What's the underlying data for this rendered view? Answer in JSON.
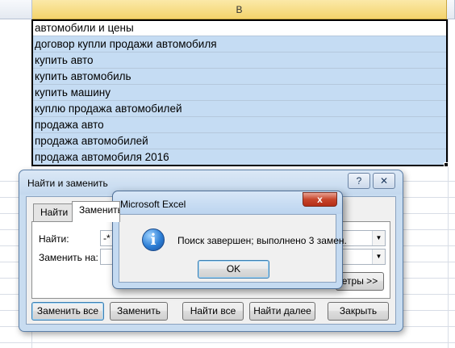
{
  "sheet": {
    "column_b_header": "B",
    "rows": [
      "автомобили и цены",
      "договор купли продажи автомобиля",
      "купить авто",
      "купить автомобиль",
      "купить машину",
      "куплю продажа автомобилей",
      "продажа авто",
      "продажа автомобилей",
      "продажа автомобиля 2016"
    ]
  },
  "find_dialog": {
    "title": "Найти и заменить",
    "help_label": "?",
    "close_label": "✕",
    "tabs": [
      "Найти",
      "Заменить"
    ],
    "find_label": "Найти:",
    "replace_label": "Заменить на:",
    "find_value": "-*",
    "replace_value": "",
    "params_label": "етры >>",
    "buttons": {
      "replace_all": "Заменить все",
      "replace": "Заменить",
      "find_all": "Найти все",
      "find_next": "Найти далее",
      "close": "Закрыть"
    }
  },
  "message_box": {
    "title": "Microsoft Excel",
    "close_label": "x",
    "icon": "information-icon",
    "message": "Поиск завершен; выполнено 3 замен.",
    "ok_label": "OK"
  },
  "colors": {
    "selection": "#c5dcf3",
    "header_selected": "#f3d36c",
    "dialog_frame": "#c8dcf0"
  }
}
